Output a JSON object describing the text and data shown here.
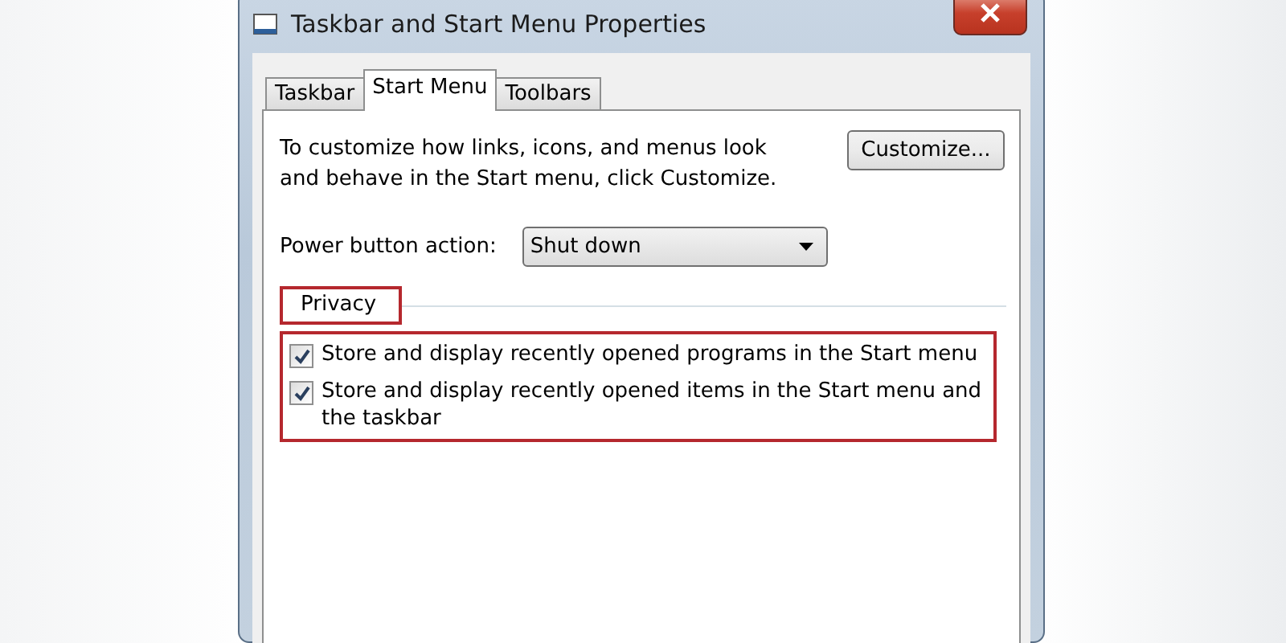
{
  "window": {
    "title": "Taskbar and Start Menu Properties"
  },
  "tabs": [
    {
      "label": "Taskbar",
      "selected": false
    },
    {
      "label": "Start Menu",
      "selected": true
    },
    {
      "label": "Toolbars",
      "selected": false
    }
  ],
  "description": "To customize how links, icons, and menus look and behave in the Start menu, click Customize.",
  "customize_button": "Customize...",
  "power_button": {
    "label": "Power button action:",
    "value": "Shut down"
  },
  "privacy": {
    "title": "Privacy",
    "title_highlighted": true,
    "options_highlighted": true,
    "options": [
      {
        "label": "Store and display recently opened programs in the Start menu",
        "checked": true
      },
      {
        "label": "Store and display recently opened items in the Start menu and the taskbar",
        "checked": true
      }
    ]
  }
}
